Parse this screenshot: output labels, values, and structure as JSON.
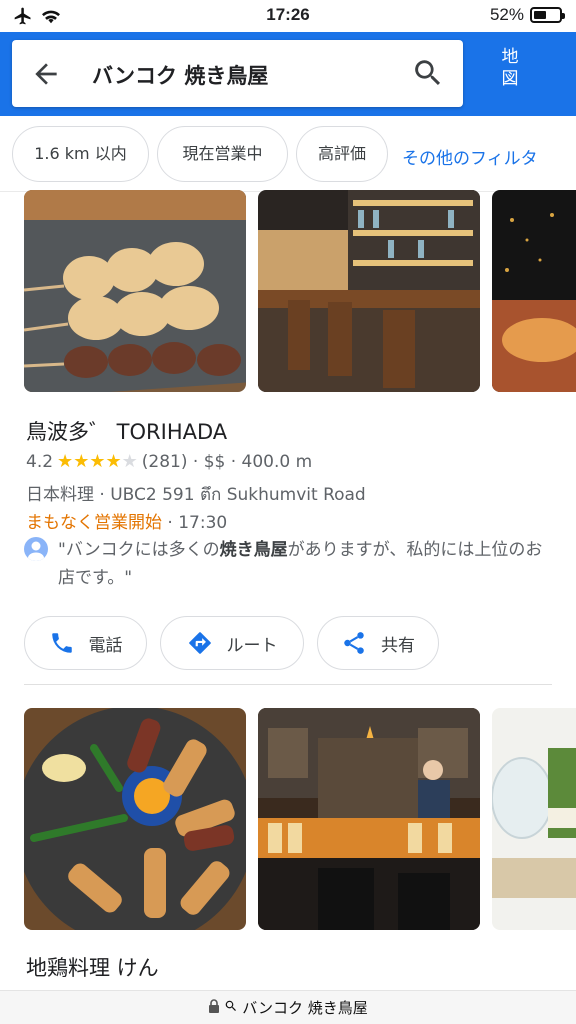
{
  "status_bar": {
    "time": "17:26",
    "battery_percent": "52%",
    "battery_level": 0.52
  },
  "search": {
    "query": "バンコク 焼き鳥屋",
    "map_button": [
      "地",
      "図"
    ]
  },
  "filters": {
    "chips": [
      "1.6 km 以内",
      "現在営業中",
      "高評価"
    ],
    "more": "その他のフィルタ"
  },
  "listings": [
    {
      "name": "鳥波多゛ TORIHADA",
      "rating": "4.2",
      "stars_filled": 4,
      "reviews": "(281)",
      "price": "$$",
      "distance": "400.0 m",
      "category": "日本料理 · UBC2 591 ตึก Sukhumvit Road",
      "hours_status": "まもなく営業開始",
      "hours_time": "· 17:30",
      "review_pre": "\"バンコクには多くの",
      "review_bold": "焼き鳥屋",
      "review_post": "がありますが、私的には上位のお店です。\"",
      "actions": {
        "call": "電話",
        "route": "ルート",
        "share": "共有"
      }
    },
    {
      "name": "地鶏料理 けん"
    }
  ],
  "url_bar": {
    "text": "バンコク 焼き鳥屋"
  },
  "colors": {
    "brand_blue": "#1a73e8",
    "star": "#fbbc04",
    "open_soon": "#e37400"
  }
}
